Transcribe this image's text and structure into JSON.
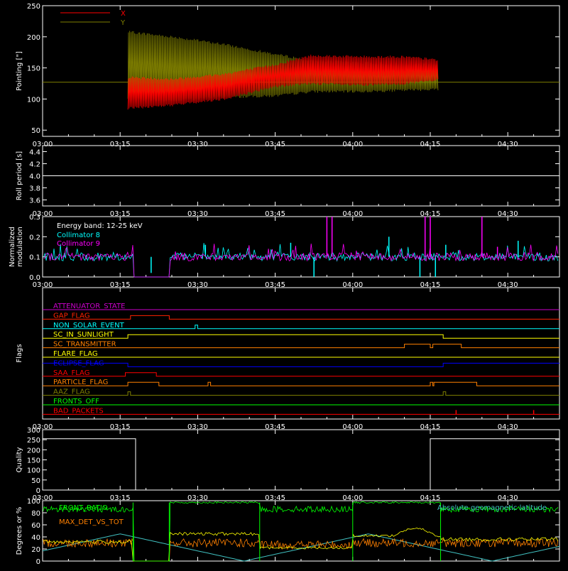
{
  "xaxis": {
    "min_minutes": 0,
    "max_minutes": 100,
    "ticks": [
      {
        "label": "03:00",
        "value": 0
      },
      {
        "label": "03:15",
        "value": 15
      },
      {
        "label": "03:30",
        "value": 30
      },
      {
        "label": "03:45",
        "value": 45
      },
      {
        "label": "04:00",
        "value": 60
      },
      {
        "label": "04:15",
        "value": 75
      },
      {
        "label": "04:30",
        "value": 90
      }
    ]
  },
  "chart_data": [
    {
      "type": "line",
      "panel": "pointing",
      "ylabel": "Pointing [\"]",
      "ylim": [
        40,
        250
      ],
      "yticks": [
        50,
        100,
        150,
        200,
        250
      ],
      "baseline": 127,
      "series": [
        {
          "name": "X",
          "color": "#ff0000",
          "envelope": [
            [
              16.5,
              85,
              135
            ],
            [
              25,
              90,
              132
            ],
            [
              35,
              100,
              140
            ],
            [
              45,
              120,
              155
            ],
            [
              52,
              125,
              170
            ],
            [
              62,
              122,
              168
            ],
            [
              70,
              125,
              168
            ],
            [
              76.5,
              130,
              163
            ]
          ]
        },
        {
          "name": "Y",
          "color": "#808000",
          "envelope": [
            [
              16.5,
              100,
              208
            ],
            [
              25,
              97,
              200
            ],
            [
              35,
              103,
              188
            ],
            [
              45,
              105,
              172
            ],
            [
              52,
              112,
              162
            ],
            [
              62,
              112,
              158
            ],
            [
              70,
              114,
              157
            ],
            [
              76.5,
              116,
              154
            ]
          ]
        }
      ]
    },
    {
      "type": "line",
      "panel": "roll_period",
      "ylabel": "Roll period [s]",
      "ylim": [
        3.5,
        4.5
      ],
      "yticks": [
        3.6,
        3.8,
        4.0,
        4.2,
        4.4
      ],
      "series": [
        {
          "name": "",
          "color": "#ffffff",
          "x": [
            0,
            100
          ],
          "y": [
            4.0,
            4.0
          ]
        }
      ]
    },
    {
      "type": "line",
      "panel": "modulation",
      "ylabel": "Normalized modulation",
      "ylim": [
        0,
        0.3
      ],
      "yticks": [
        0.0,
        0.1,
        0.2,
        0.3
      ],
      "annotation": "Energy band: 12-25 keV",
      "series": [
        {
          "name": "Collimator 8",
          "color": "#00ffff",
          "level": 0.1,
          "gaps": [
            [
              17.5,
              24.5
            ]
          ],
          "spikes": [
            [
              21,
              0.02
            ],
            [
              52.5,
              0.0
            ],
            [
              73,
              0.0
            ],
            [
              76,
              0.0
            ],
            [
              31.5,
              0.16
            ],
            [
              48,
              0.17
            ],
            [
              67,
              0.2
            ],
            [
              78,
              0.16
            ],
            [
              92,
              0.18
            ]
          ]
        },
        {
          "name": "Collimator 9",
          "color": "#ff00ff",
          "level": 0.1,
          "gaps": [
            [
              17.5,
              24.5
            ]
          ],
          "spikes": [
            [
              55,
              0.3
            ],
            [
              56,
              0.3
            ],
            [
              74,
              0.3
            ],
            [
              75,
              0.3
            ],
            [
              85,
              0.3
            ],
            [
              88,
              0.15
            ]
          ]
        }
      ]
    },
    {
      "type": "line",
      "panel": "flags",
      "ylabel": "Flags",
      "series": [
        {
          "name": "ATTENUATOR_STATE",
          "color": "#cc00cc",
          "steps": []
        },
        {
          "name": "GAP_FLAG",
          "color": "#ff2200",
          "steps": [
            [
              17,
              24.5
            ]
          ]
        },
        {
          "name": "NON_SOLAR_EVENT",
          "color": "#00ffff",
          "steps": [
            [
              29.5,
              30
            ]
          ]
        },
        {
          "name": "SC_IN_SUNLIGHT",
          "color": "#ffff00",
          "steps": [
            [
              16.5,
              77.5
            ]
          ]
        },
        {
          "name": "SC_TRANSMITTER",
          "color": "#ff8000",
          "steps": [
            [
              70,
              75
            ],
            [
              75.5,
              81
            ]
          ]
        },
        {
          "name": "FLARE_FLAG",
          "color": "#ffff00",
          "steps": []
        },
        {
          "name": "ECLIPSE_FLAG",
          "color": "#0000ff",
          "steps": [
            [
              0,
              16.5
            ],
            [
              77.5,
              100
            ]
          ],
          "invert": false
        },
        {
          "name": "SAA_FLAG",
          "color": "#ff0000",
          "steps": [
            [
              16,
              22
            ]
          ]
        },
        {
          "name": "PARTICLE_FLAG",
          "color": "#ff8000",
          "steps": [
            [
              16.5,
              22.5
            ],
            [
              32,
              32.5
            ],
            [
              75,
              75.5
            ],
            [
              75.7,
              84
            ]
          ]
        },
        {
          "name": "AAZ_FLAG",
          "color": "#808000",
          "steps": [
            [
              16.5,
              17
            ],
            [
              77.5,
              78
            ]
          ]
        },
        {
          "name": "FRONTS_OFF",
          "color": "#00ff00",
          "steps": []
        },
        {
          "name": "BAD_PACKETS",
          "color": "#ff0000",
          "steps": [],
          "spikes": [
            80,
            95
          ]
        }
      ]
    },
    {
      "type": "line",
      "panel": "quality",
      "ylabel": "Quality",
      "ylim": [
        0,
        300
      ],
      "yticks": [
        0,
        50,
        100,
        150,
        200,
        250,
        300
      ],
      "series": [
        {
          "name": "",
          "color": "#ffffff",
          "x": [
            0,
            18,
            18,
            75,
            75,
            100
          ],
          "y": [
            255,
            255,
            0,
            0,
            255,
            255
          ]
        }
      ]
    },
    {
      "type": "line",
      "panel": "percent",
      "ylabel": "Degrees or %",
      "ylim": [
        0,
        100
      ],
      "yticks": [
        0,
        20,
        40,
        60,
        80,
        100
      ],
      "annotation": "Absolute geomagnetic latitude",
      "series": [
        {
          "name": "FRONT_RATIO",
          "color": "#00ff00"
        },
        {
          "name": "",
          "color": "#ffff00"
        },
        {
          "name": "MAX_DET_VS_TOT",
          "color": "#ff8000"
        },
        {
          "name": "Absolute geomagnetic latitude",
          "color": "#40c0c0"
        }
      ]
    }
  ]
}
